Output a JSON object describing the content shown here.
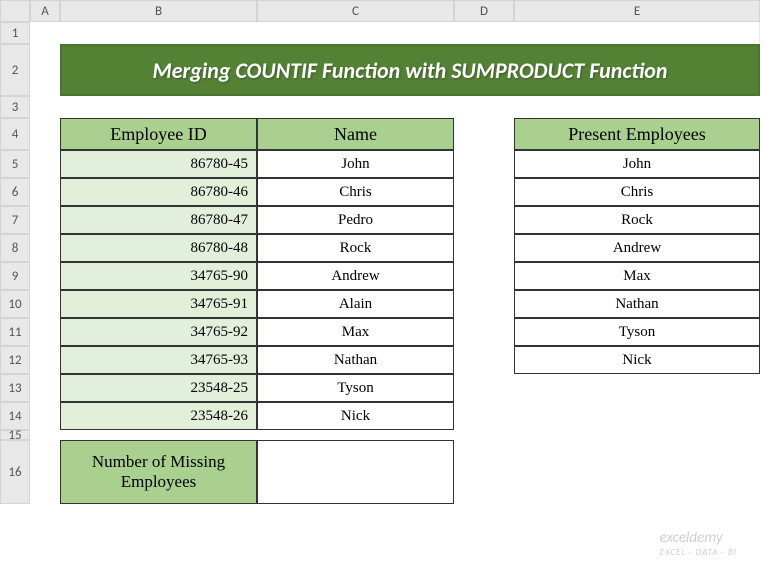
{
  "columns": [
    "A",
    "B",
    "C",
    "D",
    "E"
  ],
  "rows": [
    "1",
    "2",
    "3",
    "4",
    "5",
    "6",
    "7",
    "8",
    "9",
    "10",
    "11",
    "12",
    "13",
    "14",
    "15",
    "16"
  ],
  "title": "Merging COUNTIF Function with SUMPRODUCT Function",
  "headers": {
    "employee_id": "Employee ID",
    "name": "Name",
    "present": "Present Employees"
  },
  "employees": [
    {
      "id": "86780-45",
      "name": "John"
    },
    {
      "id": "86780-46",
      "name": "Chris"
    },
    {
      "id": "86780-47",
      "name": "Pedro"
    },
    {
      "id": "86780-48",
      "name": "Rock"
    },
    {
      "id": "34765-90",
      "name": "Andrew"
    },
    {
      "id": "34765-91",
      "name": "Alain"
    },
    {
      "id": "34765-92",
      "name": "Max"
    },
    {
      "id": "34765-93",
      "name": "Nathan"
    },
    {
      "id": "23548-25",
      "name": "Tyson"
    },
    {
      "id": "23548-26",
      "name": "Nick"
    }
  ],
  "present_employees": [
    "John",
    "Chris",
    "Rock",
    "Andrew",
    "Max",
    "Nathan",
    "Tyson",
    "Nick"
  ],
  "missing_label": "Number of Missing Employees",
  "missing_value": "",
  "watermark": {
    "main": "exceldemy",
    "sub": "EXCEL · DATA · BI"
  }
}
